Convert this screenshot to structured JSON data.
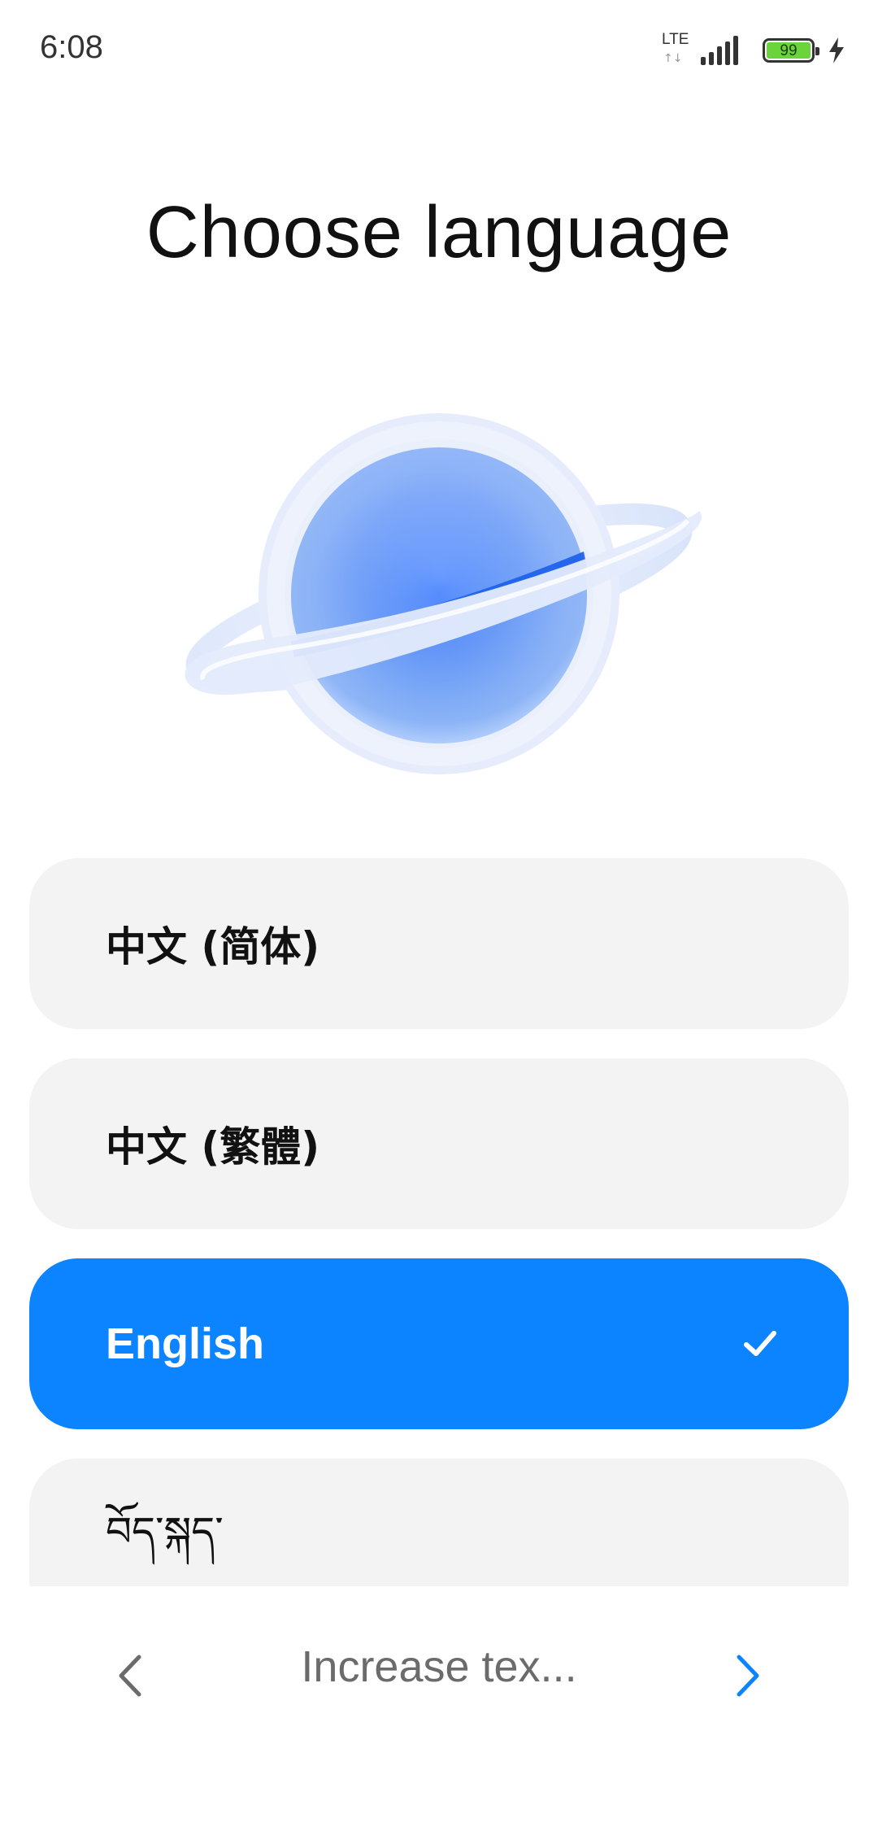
{
  "status_bar": {
    "time": "6:08",
    "network_label": "LTE",
    "network_arrows": "↑↓",
    "battery_level": "99",
    "icons": [
      "signal-icon",
      "battery-icon",
      "charging-icon"
    ]
  },
  "page": {
    "title": "Choose language",
    "illustration": "planet-icon"
  },
  "languages": [
    {
      "label": "中文 (简体)",
      "selected": false
    },
    {
      "label": "中文 (繁體)",
      "selected": false
    },
    {
      "label": "English",
      "selected": true
    },
    {
      "label": "བོད་སྐད་",
      "selected": false
    }
  ],
  "bottom_nav": {
    "back_icon": "chevron-left-icon",
    "center_label": "Increase tex...",
    "next_icon": "chevron-right-icon"
  },
  "colors": {
    "accent": "#0d84ff",
    "item_background": "#f3f3f3",
    "battery": "#6ad43a"
  }
}
